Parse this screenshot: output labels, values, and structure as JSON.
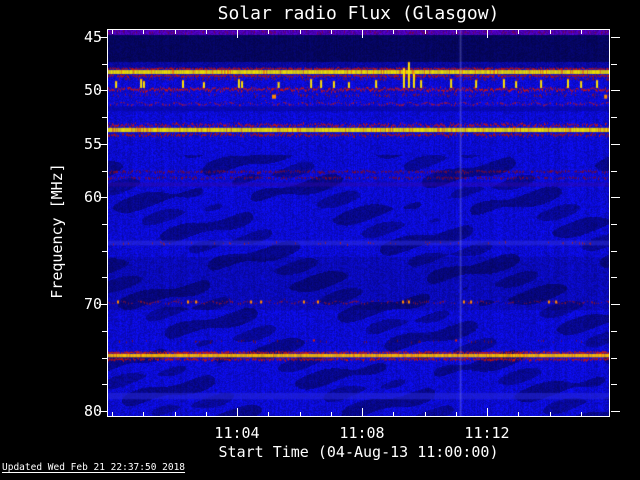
{
  "figure": {
    "background": "#000000",
    "text_color": "#ffffff",
    "tick_color": "#ffffff",
    "border_color": "#ffffff"
  },
  "footer": {
    "updated": "Updated Wed Feb 21 22:37:50 2018"
  },
  "chart_data": {
    "type": "heatmap",
    "subtype": "radio-spectrogram",
    "title": "Solar radio Flux (Glasgow)",
    "xlabel": "Start Time (04-Aug-13 11:00:00)",
    "ylabel": "Frequency [MHz]",
    "legend": "none",
    "grid": false,
    "x_axis": {
      "start_time": "11:00:00",
      "date": "04-Aug-13",
      "range_min": [
        -0.128,
        15.904
      ],
      "major_ticks_min": [
        4,
        8,
        12
      ],
      "major_tick_labels": [
        "11:04",
        "11:08",
        "11:12"
      ],
      "minor_ticks_min": [
        0,
        1,
        2,
        3,
        5,
        6,
        7,
        9,
        10,
        11,
        13,
        14,
        15
      ]
    },
    "y_axis": {
      "range_mhz": [
        44.35,
        80.46
      ],
      "major_ticks_mhz": [
        45,
        50,
        55,
        60,
        70,
        80
      ],
      "minor_ticks_mhz": [
        47.5,
        52.5,
        57.5,
        62.5,
        65,
        67.5,
        72.5,
        75,
        77.5
      ]
    },
    "background": {
      "base_blue": "#0b0bd0",
      "dark_navy": "#05055e",
      "top_purple": "#4a00b4",
      "transition": "#0808a0",
      "purple_until_mhz": 44.75,
      "navy_until_mhz": 47.3,
      "transition_until_mhz": 47.95
    },
    "bands": [
      {
        "name": "top-row-specks",
        "f1": 44.35,
        "f2": 44.72,
        "style": "speckle",
        "color": "#7a0040",
        "density": 0.3
      },
      {
        "name": "48mhz-upper-red",
        "f1": 47.8,
        "f2": 48.1,
        "style": "speckle",
        "color": "#d01400",
        "density": 0.92
      },
      {
        "name": "48mhz-yellow-core",
        "f1": 48.1,
        "f2": 48.47,
        "style": "solid",
        "color": "#f0e000"
      },
      {
        "name": "48mhz-lower-red",
        "f1": 48.47,
        "f2": 48.76,
        "style": "speckle",
        "color": "#c01000",
        "density": 0.85
      },
      {
        "name": "48.9mhz-faint",
        "f1": 48.8,
        "f2": 49.02,
        "style": "speckle",
        "color": "#801030",
        "density": 0.25
      },
      {
        "name": "50mhz-red-line",
        "f1": 49.6,
        "f2": 50.18,
        "style": "speckle",
        "color": "#d81400",
        "density": 0.95
      },
      {
        "name": "50mhz-fade",
        "f1": 50.18,
        "f2": 50.65,
        "style": "speckle",
        "color": "#8a1228",
        "density": 0.3
      },
      {
        "name": "51mhz-dotline",
        "f1": 51.0,
        "f2": 51.4,
        "style": "dotline",
        "color": "#a51530",
        "density": 0.6
      },
      {
        "name": "52mhz-dark-row",
        "f1": 51.5,
        "f2": 51.95,
        "style": "row",
        "color": "#05058c",
        "alpha": 0.5
      },
      {
        "name": "53mhz-upper-red",
        "f1": 52.95,
        "f2": 53.5,
        "style": "speckle",
        "color": "#d01400",
        "density": 0.85
      },
      {
        "name": "53mhz-yellow-core",
        "f1": 53.5,
        "f2": 53.9,
        "style": "solid",
        "color": "#f0e000"
      },
      {
        "name": "53mhz-lower-red",
        "f1": 53.9,
        "f2": 54.35,
        "style": "speckle",
        "color": "#b81000",
        "density": 0.8
      },
      {
        "name": "maroon-row-1",
        "f1": 57.4,
        "f2": 57.75,
        "style": "speckle",
        "color": "#7c0a2a",
        "density": 0.65
      },
      {
        "name": "maroon-row-2",
        "f1": 58.0,
        "f2": 58.3,
        "style": "speckle",
        "color": "#7c0a2a",
        "density": 0.5
      },
      {
        "name": "purple-row",
        "f1": 58.6,
        "f2": 59.0,
        "style": "row",
        "color": "#3808a8",
        "alpha": 0.4
      },
      {
        "name": "64mhz-light-row",
        "f1": 64.05,
        "f2": 64.5,
        "style": "row",
        "color": "#3030e0",
        "alpha": 0.5
      },
      {
        "name": "64mhz-red-specks",
        "f1": 64.05,
        "f2": 64.5,
        "style": "speckle",
        "color": "#a02020",
        "density": 0.1
      },
      {
        "name": "70mhz-dotline",
        "f1": 69.6,
        "f2": 69.95,
        "style": "dotline",
        "color": "#8e122c",
        "density": 0.5
      },
      {
        "name": "73mhz-faint",
        "f1": 73.3,
        "f2": 73.6,
        "style": "speckle",
        "color": "#6e1028",
        "density": 0.12
      },
      {
        "name": "75mhz-upper-red",
        "f1": 74.35,
        "f2": 74.65,
        "style": "speckle",
        "color": "#e01800",
        "density": 0.92
      },
      {
        "name": "75mhz-orange-core",
        "f1": 74.65,
        "f2": 74.97,
        "style": "solid",
        "color": "#ffc000"
      },
      {
        "name": "75mhz-lower-red",
        "f1": 74.97,
        "f2": 75.3,
        "style": "speckle",
        "color": "#cc1400",
        "density": 0.85
      },
      {
        "name": "78.5mhz-light-row",
        "f1": 78.3,
        "f2": 78.9,
        "style": "row",
        "color": "#2828dc",
        "alpha": 0.55
      }
    ],
    "rfi_spike_base_mhz": 49.77,
    "rfi_spike_color": "#ffe400",
    "rfi_spikes_min_height": [
      [
        0.1,
        7
      ],
      [
        0.9,
        9
      ],
      [
        0.99,
        7
      ],
      [
        2.24,
        8
      ],
      [
        2.91,
        6
      ],
      [
        4.03,
        9
      ],
      [
        4.13,
        7
      ],
      [
        5.3,
        6
      ],
      [
        6.34,
        9
      ],
      [
        6.66,
        8
      ],
      [
        7.07,
        7
      ],
      [
        7.55,
        6
      ],
      [
        8.42,
        8
      ],
      [
        9.31,
        20
      ],
      [
        9.47,
        26
      ],
      [
        9.63,
        15
      ],
      [
        9.86,
        8
      ],
      [
        10.82,
        9
      ],
      [
        11.62,
        8
      ],
      [
        12.51,
        9
      ],
      [
        12.9,
        7
      ],
      [
        13.7,
        8
      ],
      [
        14.56,
        9
      ],
      [
        14.98,
        7
      ],
      [
        15.49,
        8
      ]
    ],
    "dot_row_mhz": 69.75,
    "dot_color": "#ff8800",
    "dots_70mhz_min": [
      0.16,
      2.4,
      2.66,
      4.42,
      4.74,
      6.11,
      6.56,
      9.28,
      9.47,
      11.23,
      11.46,
      13.95,
      14.18
    ],
    "blips": [
      {
        "t": 5.12,
        "f": 50.4,
        "w": 4,
        "h": 4,
        "color": "#ff8800"
      },
      {
        "t": 15.75,
        "f": 50.4,
        "w": 3,
        "h": 4,
        "color": "#ff8800"
      },
      {
        "t": 6.43,
        "f": 73.3,
        "w": 2,
        "h": 2,
        "color": "#dd2200"
      },
      {
        "t": 10.98,
        "f": 73.3,
        "w": 2,
        "h": 2,
        "color": "#dd2200"
      }
    ],
    "vertical_line_min": 11.14
  }
}
